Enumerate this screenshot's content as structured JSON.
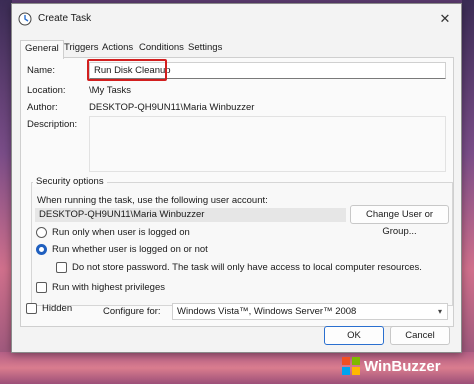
{
  "window": {
    "title": "Create Task",
    "close_symbol": "✕"
  },
  "tabs": [
    {
      "label": "General",
      "active": true
    },
    {
      "label": "Triggers",
      "active": false
    },
    {
      "label": "Actions",
      "active": false
    },
    {
      "label": "Conditions",
      "active": false
    },
    {
      "label": "Settings",
      "active": false
    }
  ],
  "general": {
    "name_label": "Name:",
    "name_value": "Run Disk Cleanup",
    "location_label": "Location:",
    "location_value": "\\My Tasks",
    "author_label": "Author:",
    "author_value": "DESKTOP-QH9UN11\\Maria Winbuzzer",
    "description_label": "Description:",
    "description_value": ""
  },
  "security": {
    "group_title": "Security options",
    "account_prompt": "When running the task, use the following user account:",
    "account_value": "DESKTOP-QH9UN11\\Maria Winbuzzer",
    "change_button": "Change User or Group...",
    "option_logged_on": "Run only when user is logged on",
    "option_whether": "Run whether user is logged on or not",
    "option_whether_selected": true,
    "no_store_password": "Do not store password.  The task will only have access to local computer resources.",
    "highest_privileges": "Run with highest privileges"
  },
  "bottom": {
    "hidden_label": "Hidden",
    "configure_label": "Configure for:",
    "configure_value": "Windows Vista™, Windows Server™ 2008"
  },
  "buttons": {
    "ok": "OK",
    "cancel": "Cancel"
  },
  "watermark": {
    "text": "WinBuzzer"
  },
  "colors": {
    "highlight_border": "#d21f1f",
    "accent": "#1f5fbf"
  }
}
